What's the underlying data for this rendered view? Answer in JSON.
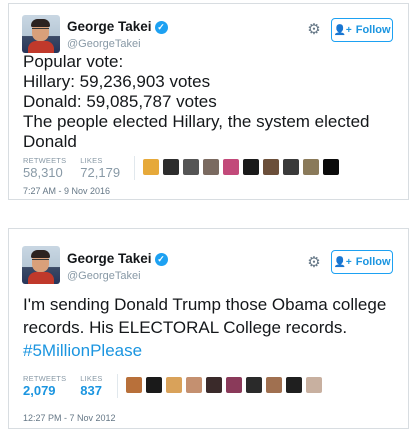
{
  "tweets": [
    {
      "author_name": "George Takei",
      "handle": "@GeorgeTakei",
      "follow_label": "Follow",
      "text_lines": [
        "Popular vote:",
        "Hillary: 59,236,903 votes",
        "Donald: 59,085,787 votes",
        "The people elected Hillary, the system elected Donald"
      ],
      "retweets_label": "RETWEETS",
      "retweets": "58,310",
      "likes_label": "LIKES",
      "likes": "72,179",
      "timestamp": "7:27 AM - 9 Nov 2016",
      "liker_colors": [
        "#e6a93a",
        "#2d2d2d",
        "#555555",
        "#7a6a60",
        "#c24a7a",
        "#1a1a1a",
        "#6b4f3a",
        "#3a3a3a",
        "#8a7a5a",
        "#0b0b0b"
      ]
    },
    {
      "author_name": "George Takei",
      "handle": "@GeorgeTakei",
      "follow_label": "Follow",
      "text_lines": [
        "I'm sending Donald Trump those Obama college records. His ELECTORAL College records."
      ],
      "hashtag": "#5MillionPlease",
      "retweets_label": "RETWEETS",
      "retweets": "2,079",
      "likes_label": "LIKES",
      "likes": "837",
      "timestamp": "12:27 PM - 7 Nov 2012",
      "liker_colors": [
        "#b8703a",
        "#1a1a1a",
        "#d9a25a",
        "#c49070",
        "#3a2a2a",
        "#8a3a5a",
        "#2a2a2a",
        "#a07050",
        "#1f1f1f",
        "#c8b0a0"
      ]
    }
  ],
  "colors": {
    "accent": "#1da1f2",
    "text": "#14171a",
    "muted": "#8899a6"
  }
}
